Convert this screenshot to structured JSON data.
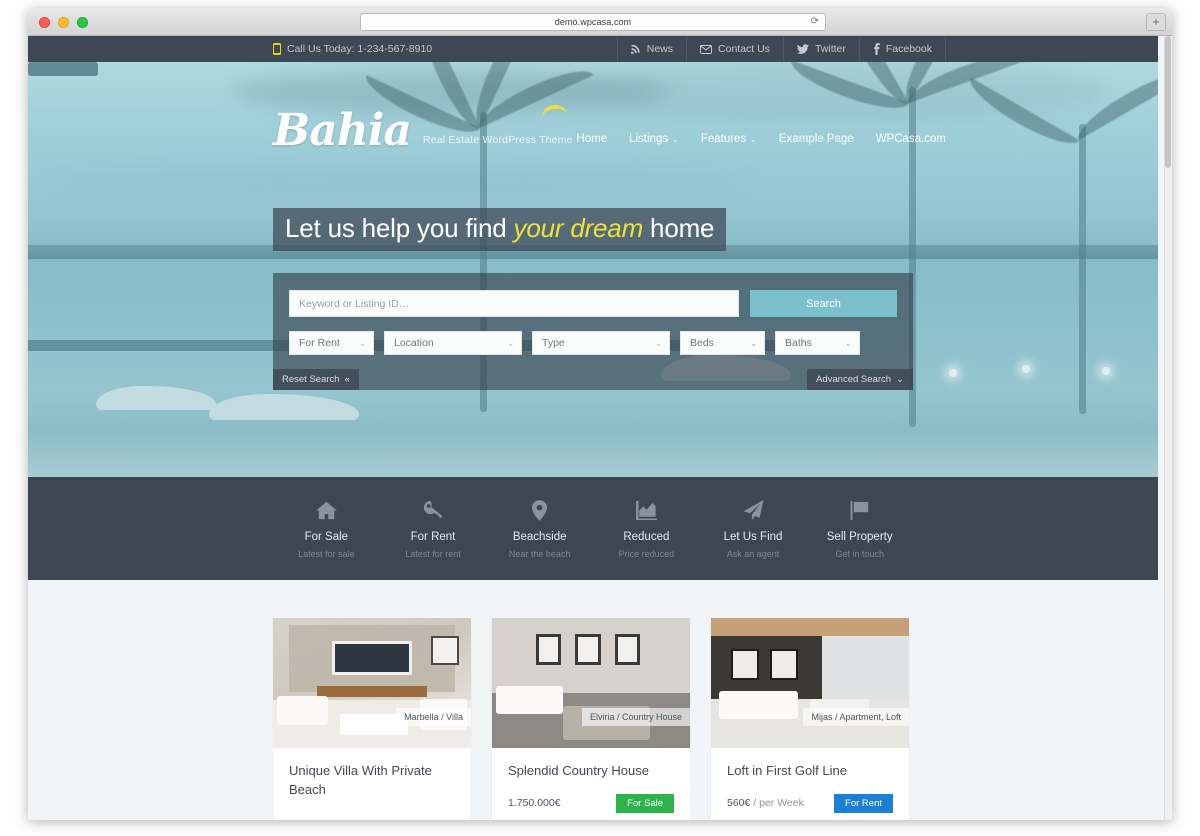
{
  "browser": {
    "url": "demo.wpcasa.com",
    "reload_icon": "reload-icon",
    "new_tab_label": "+"
  },
  "topbar": {
    "phone_text": "Call Us Today: 1-234-567-8910",
    "links": [
      {
        "label": "News",
        "icon": "rss-icon"
      },
      {
        "label": "Contact Us",
        "icon": "envelope-icon"
      },
      {
        "label": "Twitter",
        "icon": "twitter-icon"
      },
      {
        "label": "Facebook",
        "icon": "facebook-icon"
      }
    ]
  },
  "header": {
    "logo": "Bahia",
    "tagline": "Real Estate WordPress Theme",
    "nav": [
      {
        "label": "Home",
        "caret": false
      },
      {
        "label": "Listings",
        "caret": true
      },
      {
        "label": "Features",
        "caret": true
      },
      {
        "label": "Example Page",
        "caret": false
      },
      {
        "label": "WPCasa.com",
        "caret": false
      }
    ],
    "caret_glyph": "⌄"
  },
  "hero": {
    "headline_pre": "Let us help you find ",
    "headline_em": "your dream",
    "headline_post": " home"
  },
  "search": {
    "keyword_placeholder": "Keyword or Listing ID…",
    "keyword_value": "",
    "search_button": "Search",
    "selects": [
      {
        "name": "offer-type",
        "value": "For Rent"
      },
      {
        "name": "location",
        "value": "Location"
      },
      {
        "name": "type",
        "value": "Type"
      },
      {
        "name": "beds",
        "value": "Beds"
      },
      {
        "name": "baths",
        "value": "Baths"
      }
    ],
    "reset_label": "Reset Search",
    "reset_glyph": "«",
    "advanced_label": "Advanced Search",
    "advanced_glyph": "⌄"
  },
  "features": [
    {
      "icon": "home-icon",
      "title": "For Sale",
      "subtitle": "Latest for sale"
    },
    {
      "icon": "key-icon",
      "title": "For Rent",
      "subtitle": "Latest for rent"
    },
    {
      "icon": "map-pin-icon",
      "title": "Beachside",
      "subtitle": "Near the beach"
    },
    {
      "icon": "chart-icon",
      "title": "Reduced",
      "subtitle": "Price reduced"
    },
    {
      "icon": "paper-plane-icon",
      "title": "Let Us Find",
      "subtitle": "Ask an agent"
    },
    {
      "icon": "flag-icon",
      "title": "Sell Property",
      "subtitle": "Get in touch"
    }
  ],
  "listings": [
    {
      "overlay": "Marbella / Villa",
      "title": "Unique Villa With Private Beach",
      "price": "",
      "price_suffix": "",
      "badge": "",
      "badge_kind": ""
    },
    {
      "overlay": "Elviria / Country House",
      "title": "Splendid Country House",
      "price": "1.750.000€",
      "price_suffix": "",
      "badge": "For Sale",
      "badge_kind": "sale"
    },
    {
      "overlay": "Mijas / Apartment, Loft",
      "title": "Loft in First Golf Line",
      "price": "560€",
      "price_suffix": " / per Week",
      "badge": "For Rent",
      "badge_kind": "rent"
    }
  ],
  "colors": {
    "accent_teal": "#7cc0ce",
    "accent_yellow": "#f2e03a",
    "dark_slate": "#3e4651",
    "topbar": "#3e4854",
    "badge_sale": "#2cb34a",
    "badge_rent": "#1d7fd4"
  }
}
